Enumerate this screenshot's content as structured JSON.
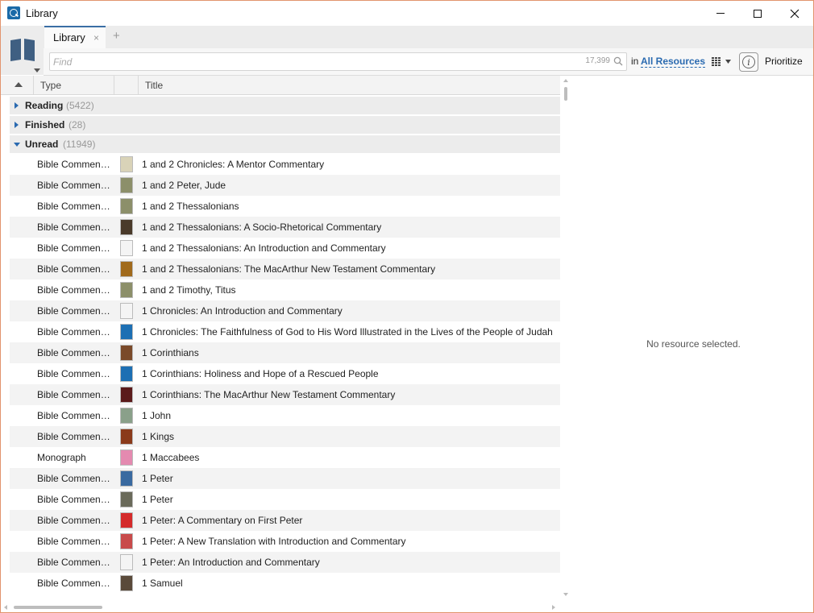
{
  "window": {
    "title": "Library",
    "controls": [
      "minimize",
      "maximize",
      "close"
    ]
  },
  "tabs": [
    {
      "label": "Library",
      "close": "×"
    }
  ],
  "tab_add": "+",
  "toolbar": {
    "find_placeholder": "Find",
    "find_count": "17,399",
    "in_label": "in",
    "scope": "All Resources",
    "prioritize_label": "Prioritize",
    "info_glyph": "i"
  },
  "columns": {
    "type": "Type",
    "title": "Title"
  },
  "groups": [
    {
      "name": "Reading",
      "count": "(5422)",
      "expanded": false
    },
    {
      "name": "Finished",
      "count": "(28)",
      "expanded": false
    },
    {
      "name": "Unread",
      "count": "(11949)",
      "expanded": true
    }
  ],
  "rows": [
    {
      "type": "Bible Commentary",
      "title": "1 and 2 Chronicles: A Mentor Commentary",
      "cover": "#d9d3b8"
    },
    {
      "type": "Bible Commentary",
      "title": "1 and 2 Peter, Jude",
      "cover": "#8c8f6a"
    },
    {
      "type": "Bible Commentary",
      "title": "1 and 2 Thessalonians",
      "cover": "#8c8f6a"
    },
    {
      "type": "Bible Commentary",
      "title": "1 and 2 Thessalonians: A Socio-Rhetorical Commentary",
      "cover": "#4a3a2a"
    },
    {
      "type": "Bible Commentary",
      "title": "1 and 2 Thessalonians: An Introduction and Commentary",
      "cover": "#f4f4f4"
    },
    {
      "type": "Bible Commentary",
      "title": "1 and 2 Thessalonians: The MacArthur New Testament Commentary",
      "cover": "#a06a1c"
    },
    {
      "type": "Bible Commentary",
      "title": "1 and 2 Timothy, Titus",
      "cover": "#8c8f6a"
    },
    {
      "type": "Bible Commentary",
      "title": "1 Chronicles: An Introduction and Commentary",
      "cover": "#f4f4f4"
    },
    {
      "type": "Bible Commentary",
      "title": "1 Chronicles: The Faithfulness of God to His Word Illustrated in the Lives of the People of Judah",
      "cover": "#1d6fb3"
    },
    {
      "type": "Bible Commentary",
      "title": "1 Corinthians",
      "cover": "#7a4a2a"
    },
    {
      "type": "Bible Commentary",
      "title": "1 Corinthians: Holiness and Hope of a Rescued People",
      "cover": "#1d6fb3"
    },
    {
      "type": "Bible Commentary",
      "title": "1 Corinthians: The MacArthur New Testament Commentary",
      "cover": "#5a1a1a"
    },
    {
      "type": "Bible Commentary",
      "title": "1 John",
      "cover": "#8aa08a"
    },
    {
      "type": "Bible Commentary",
      "title": "1 Kings",
      "cover": "#8a3a1a"
    },
    {
      "type": "Monograph",
      "title": "1 Maccabees",
      "cover": "#e48ab0"
    },
    {
      "type": "Bible Commentary",
      "title": "1 Peter",
      "cover": "#3a6aa0"
    },
    {
      "type": "Bible Commentary",
      "title": "1 Peter",
      "cover": "#6a6a5a"
    },
    {
      "type": "Bible Commentary",
      "title": "1 Peter: A Commentary on First Peter",
      "cover": "#d42a2a"
    },
    {
      "type": "Bible Commentary",
      "title": "1 Peter: A New Translation with Introduction and Commentary",
      "cover": "#c84a4a"
    },
    {
      "type": "Bible Commentary",
      "title": "1 Peter: An Introduction and Commentary",
      "cover": "#f4f4f4"
    },
    {
      "type": "Bible Commentary",
      "title": "1 Samuel",
      "cover": "#5a4a3a"
    }
  ],
  "detail": {
    "empty_message": "No resource selected."
  },
  "colors": {
    "accent": "#2a6ab0",
    "window_border": "#e2946e",
    "group_bg": "#ececec",
    "row_alt_bg": "#f3f3f3"
  },
  "icons": [
    "library-app-icon",
    "book-icon",
    "search-icon",
    "view-grid-icon",
    "info-icon",
    "sort-ascending-icon"
  ]
}
